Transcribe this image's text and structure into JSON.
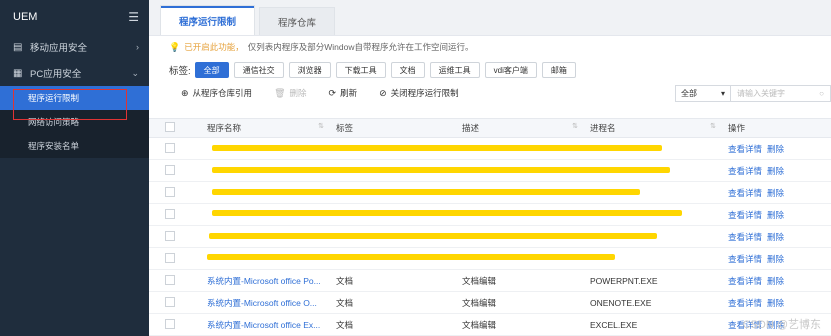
{
  "sidebar": {
    "brand": "UEM",
    "menu": [
      {
        "label": "移动应用安全"
      },
      {
        "label": "PC应用安全"
      }
    ],
    "submenu": [
      "程序运行限制",
      "网络访问策略",
      "程序安装名单"
    ]
  },
  "tabs": [
    "程序运行限制",
    "程序仓库"
  ],
  "notice": {
    "status": "已开启此功能，",
    "text": "仅列表内程序及部分Window自带程序允许在工作空间运行。"
  },
  "filters": {
    "label": "标签:",
    "chips": [
      "全部",
      "通信社交",
      "浏览器",
      "下载工具",
      "文档",
      "运维工具",
      "vdi客户端",
      "邮箱"
    ]
  },
  "toolbar": {
    "add": "从程序仓库引用",
    "delete": "删除",
    "refresh": "刷新",
    "close": "关闭程序运行限制",
    "select_value": "全部",
    "search_placeholder": "请输入关键字"
  },
  "table": {
    "headers": [
      "程序名称",
      "标签",
      "描述",
      "进程名",
      "操作"
    ],
    "actions": {
      "detail": "查看详情",
      "delete": "删除"
    },
    "rows": [
      {
        "name": "",
        "tag": "",
        "desc": "",
        "proc": ""
      },
      {
        "name": "",
        "tag": "",
        "desc": "",
        "proc": ""
      },
      {
        "name": "",
        "tag": "",
        "desc": "",
        "proc": ""
      },
      {
        "name": "",
        "tag": "",
        "desc": "",
        "proc": ""
      },
      {
        "name": "",
        "tag": "",
        "desc": "",
        "proc": ""
      },
      {
        "name": "",
        "tag": "",
        "desc": "",
        "proc": ""
      },
      {
        "name": "系统内置-Microsoft office Po...",
        "tag": "文档",
        "desc": "文档编辑",
        "proc": "POWERPNT.EXE"
      },
      {
        "name": "系统内置-Microsoft office O...",
        "tag": "文档",
        "desc": "文档编辑",
        "proc": "ONENOTE.EXE"
      },
      {
        "name": "系统内置-Microsoft office Ex...",
        "tag": "文档",
        "desc": "文档编辑",
        "proc": "EXCEL.EXE"
      }
    ]
  },
  "watermark": "CSDN @艺博东",
  "colors": {
    "accent": "#2f6fd6",
    "sidebar": "#1f2d3d",
    "highlight": "#ffd600",
    "warning": "#e6a23c"
  }
}
